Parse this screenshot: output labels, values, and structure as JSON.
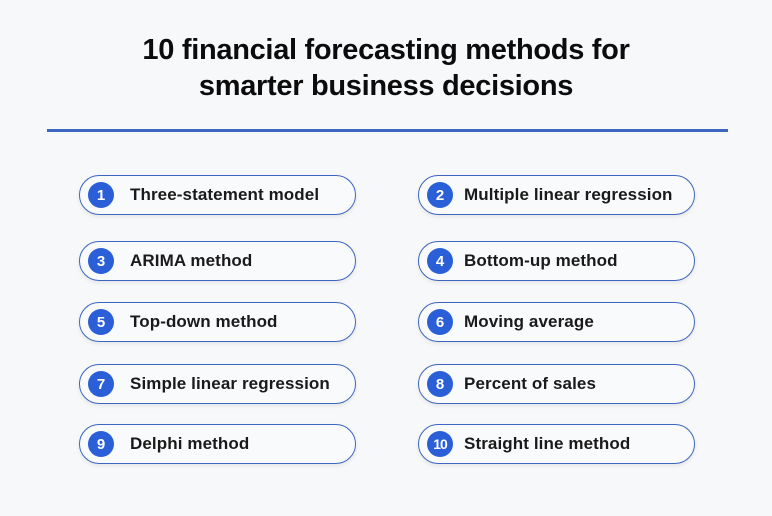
{
  "title": {
    "line1": "10 financial forecasting methods for",
    "line2": "smarter business decisions"
  },
  "colors": {
    "accent": "#2a5fd8",
    "border": "#3d66c0",
    "background": "#f7f8fa"
  },
  "methods": [
    {
      "number": "1",
      "label": "Three-statement model"
    },
    {
      "number": "2",
      "label": "Multiple linear regression"
    },
    {
      "number": "3",
      "label": "ARIMA method"
    },
    {
      "number": "4",
      "label": "Bottom-up method"
    },
    {
      "number": "5",
      "label": "Top-down method"
    },
    {
      "number": "6",
      "label": "Moving average"
    },
    {
      "number": "7",
      "label": "Simple linear regression"
    },
    {
      "number": "8",
      "label": "Percent of sales"
    },
    {
      "number": "9",
      "label": "Delphi method"
    },
    {
      "number": "10",
      "label": "Straight line method"
    }
  ]
}
